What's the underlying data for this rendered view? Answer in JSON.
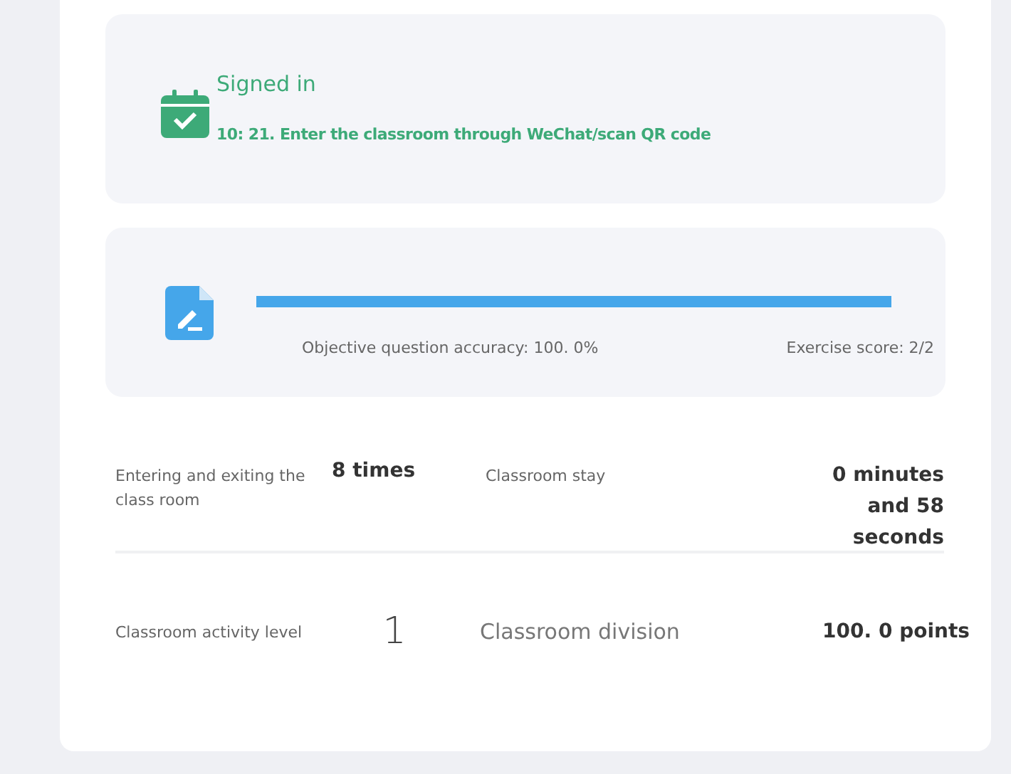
{
  "sign_in": {
    "title": "Signed in",
    "detail": "10: 21. Enter the classroom through WeChat/scan QR code"
  },
  "exercise": {
    "level": 1,
    "accuracy": "Objective question accuracy: 100. 0%",
    "score": "Exercise score: 2/2"
  },
  "stats": [
    {
      "label": "Entering and exiting the class room",
      "value": "8 times",
      "label_2": "Classroom stay",
      "value_2": "0 minutes and 58 seconds"
    },
    {
      "label": "Classroom activity level",
      "value": "1",
      "label_2": "Classroom division",
      "value_2": "100. 0 points"
    }
  ]
}
